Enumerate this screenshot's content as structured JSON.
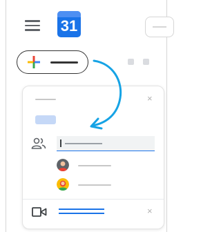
{
  "header": {
    "calendar_day": "31"
  },
  "colors": {
    "primary_blue": "#1a73e8",
    "google_red": "#ea4335",
    "google_yellow": "#fbbc04",
    "google_green": "#34a853",
    "text_dark": "#333333",
    "chip_blue": "#c5d8f7"
  },
  "icons": {
    "menu": "hamburger-menu-icon",
    "create": "multicolor-plus-icon",
    "guests": "people-icon",
    "meet": "video-camera-icon",
    "close": "close-icon",
    "arrow": "curved-arrow-icon"
  },
  "event_card": {
    "close_glyph": "×"
  }
}
